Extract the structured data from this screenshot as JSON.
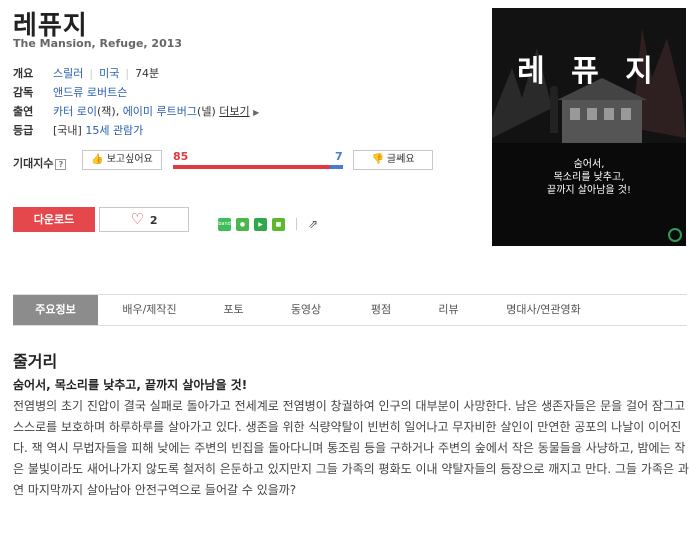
{
  "movie": {
    "title": "레퓨지",
    "subtitle": "The Mansion, Refuge, 2013"
  },
  "info": {
    "overview_label": "개요",
    "genre": "스릴러",
    "country": "미국",
    "runtime": "74분",
    "director_label": "감독",
    "director": "앤드류 로버트슨",
    "cast_label": "출연",
    "cast_1": "카터 로이",
    "cast_1_role": "(잭)",
    "cast_2": "에이미 루트버그",
    "cast_2_role": "(넬)",
    "more_label": "더보기",
    "rating_label": "등급",
    "rating_prefix": "[국내]",
    "rating": "15세 관람가"
  },
  "expectation": {
    "label": "기대지수",
    "help": "?",
    "want_label": "보고싶어요",
    "want_count": "85",
    "no_label": "글쎄요",
    "no_count": "7",
    "want_ratio": 0.924
  },
  "actions": {
    "download_label": "다운로드",
    "like_count": "2"
  },
  "share": {
    "icons": [
      "band-icon",
      "kakaostory-icon",
      "twitter-icon",
      "facebook-icon",
      "share-icon"
    ]
  },
  "poster": {
    "title": "레 퓨 지",
    "tagline_1": "숨어서,",
    "tagline_2": "목소리를 낮추고,",
    "tagline_3": "끝까지 살아남을 것!"
  },
  "tabs": [
    {
      "label": "주요정보"
    },
    {
      "label": "배우/제작진"
    },
    {
      "label": "포토"
    },
    {
      "label": "동영상"
    },
    {
      "label": "평점"
    },
    {
      "label": "리뷰"
    },
    {
      "label": "명대사/연관영화"
    }
  ],
  "plot": {
    "heading": "줄거리",
    "tagline": "숨어서, 목소리를 낮추고, 끝까지 살아남을 것!",
    "text": "전염병의 초기 진압이 결국 실패로 돌아가고 전세계로 전염병이 창궐하여 인구의 대부분이 사망한다. 남은 생존자들은 문을 걸어 잠그고 스스로를 보호하며 하루하루를 살아가고 있다. 생존을 위한 식량약탈이 빈번히 일어나고 무자비한 살인이 만연한 공포의 나날이 이어진다. 잭 역시 무법자들을 피해 낮에는 주변의 빈집을 돌아다니며 통조림 등을 구하거나 주변의 숲에서 작은 동물들을 사냥하고, 밤에는 작은 불빛이라도 새어나가지 않도록 철저히 은둔하고 있지만지 그들 가족의 평화도 이내 약탈자들의 등장으로 깨지고 만다. 그들 가족은 과연 마지막까지 살아남아 안전구역으로 들어갈 수 있을까?"
  },
  "colors": {
    "accent_red": "#e4474c",
    "accent_blue": "#4a7bd0",
    "link_blue": "#2a5fb0"
  }
}
